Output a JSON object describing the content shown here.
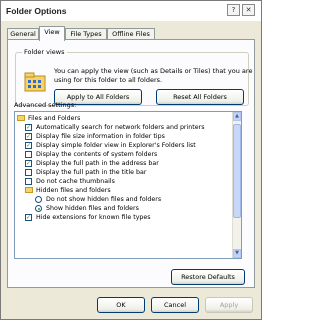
{
  "window": {
    "title": "Folder Options",
    "help_label": "?",
    "close_label": "✕"
  },
  "tabs": [
    {
      "label": "General",
      "active": false
    },
    {
      "label": "View",
      "active": true
    },
    {
      "label": "File Types",
      "active": false
    },
    {
      "label": "Offline Files",
      "active": false
    }
  ],
  "folder_views": {
    "group_label": "Folder views",
    "description": "You can apply the view (such as Details or Tiles) that you are using for this folder to all folders.",
    "apply_label": "Apply to All Folders",
    "reset_label": "Reset All Folders"
  },
  "advanced": {
    "label": "Advanced settings:",
    "items": [
      {
        "kind": "folder",
        "indent": 0,
        "label": "Files and Folders"
      },
      {
        "kind": "checkbox",
        "indent": 1,
        "checked": true,
        "label": "Automatically search for network folders and printers"
      },
      {
        "kind": "checkbox",
        "indent": 1,
        "checked": true,
        "label": "Display file size information in folder tips"
      },
      {
        "kind": "checkbox",
        "indent": 1,
        "checked": true,
        "label": "Display simple folder view in Explorer's Folders list"
      },
      {
        "kind": "checkbox",
        "indent": 1,
        "checked": false,
        "label": "Display the contents of system folders"
      },
      {
        "kind": "checkbox",
        "indent": 1,
        "checked": true,
        "label": "Display the full path in the address bar"
      },
      {
        "kind": "checkbox",
        "indent": 1,
        "checked": false,
        "label": "Display the full path in the title bar"
      },
      {
        "kind": "checkbox",
        "indent": 1,
        "checked": false,
        "label": "Do not cache thumbnails"
      },
      {
        "kind": "folder",
        "indent": 1,
        "label": "Hidden files and folders"
      },
      {
        "kind": "radio",
        "indent": 2,
        "selected": false,
        "label": "Do not show hidden files and folders"
      },
      {
        "kind": "radio",
        "indent": 2,
        "selected": true,
        "label": "Show hidden files and folders"
      },
      {
        "kind": "checkbox",
        "indent": 1,
        "checked": true,
        "label": "Hide extensions for known file types"
      }
    ],
    "restore_label": "Restore Defaults"
  },
  "footer": {
    "ok_label": "OK",
    "cancel_label": "Cancel",
    "apply_label": "Apply"
  }
}
